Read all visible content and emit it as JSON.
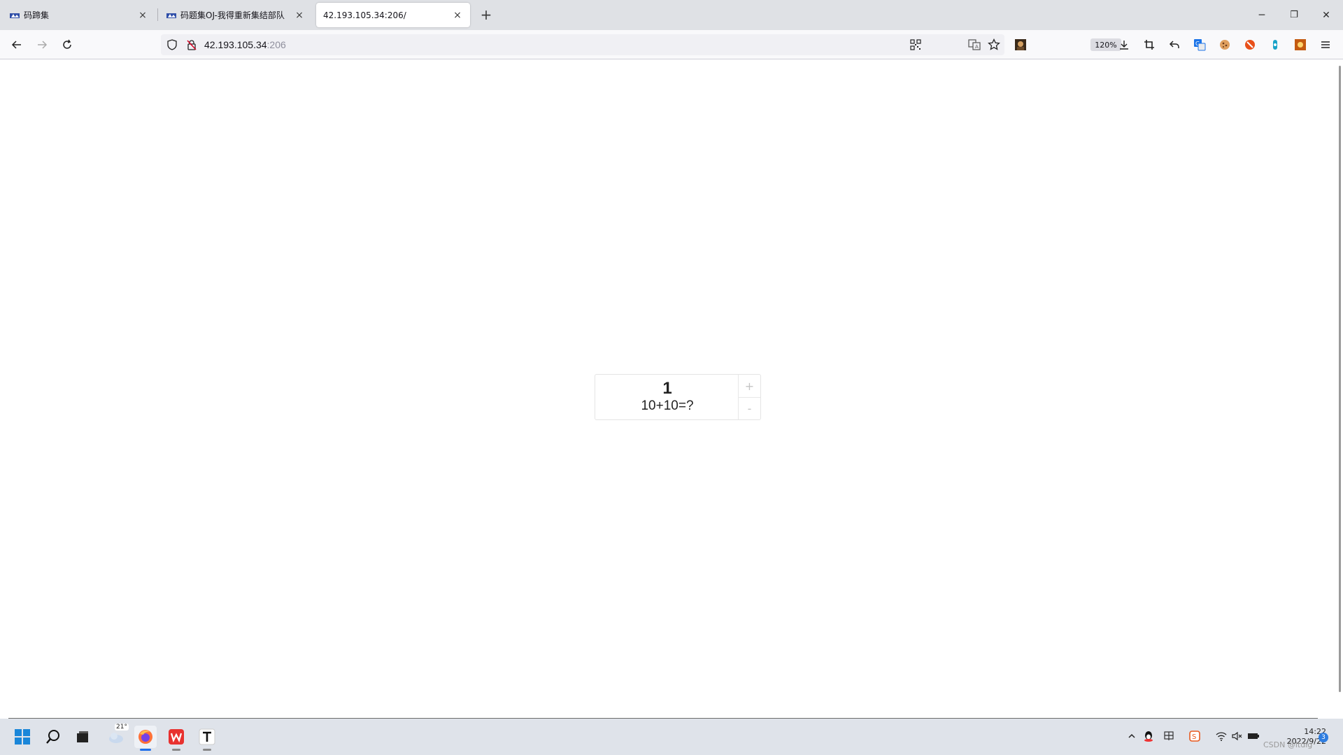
{
  "tabs": [
    {
      "title": "码蹄集",
      "close": "×"
    },
    {
      "title": "码题集OJ-我得重新集结部队",
      "close": "×"
    },
    {
      "title": "42.193.105.34:206/",
      "close": "×"
    }
  ],
  "new_tab": "+",
  "window_controls": {
    "minimize": "─",
    "restore": "❐",
    "close": "✕"
  },
  "address": {
    "host": "42.193.105.34",
    "port": ":206"
  },
  "zoom": "120%",
  "counter": {
    "value": "1",
    "question": "10+10=?",
    "plus": "+",
    "minus": "-"
  },
  "taskbar": {
    "weather_temp": "21°",
    "clock_time": "14:22",
    "clock_date": "2022/9/22",
    "notifications": "3",
    "watermark": "CSDN @ltdlg"
  }
}
